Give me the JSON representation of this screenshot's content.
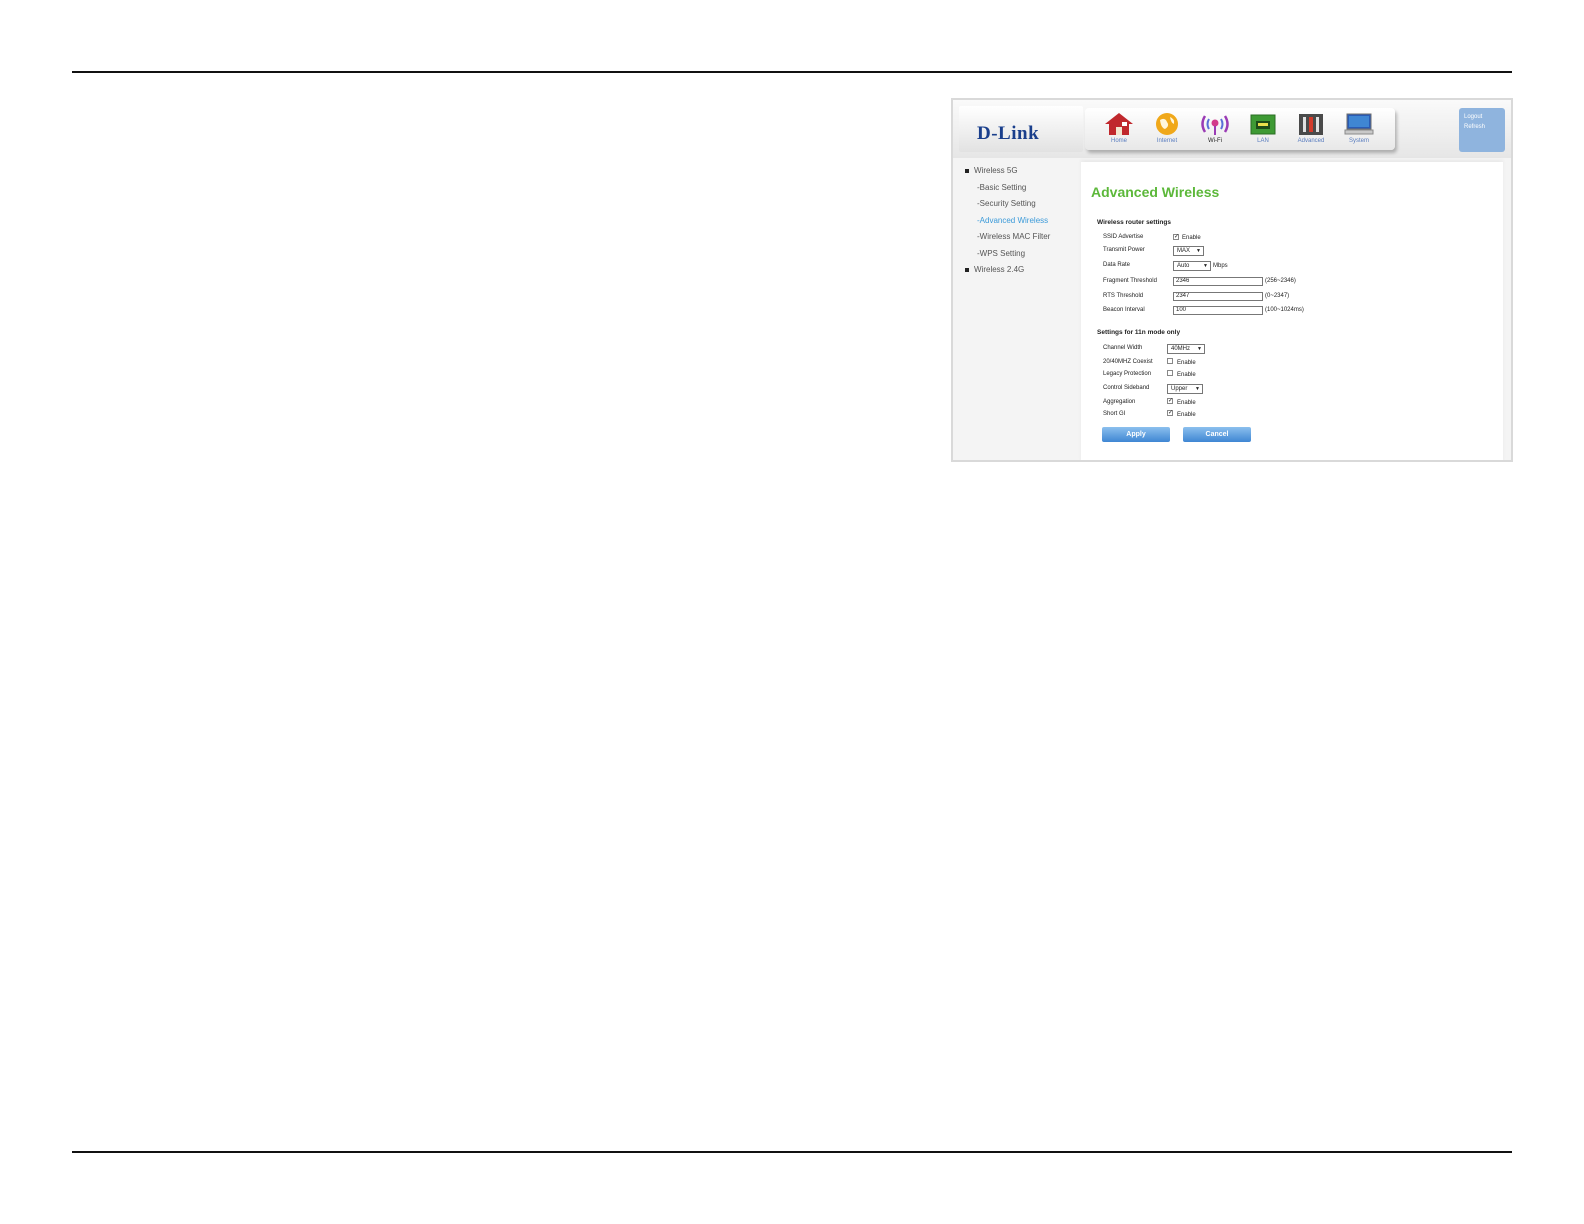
{
  "brand": {
    "logo": "D-Link"
  },
  "nav": [
    {
      "label": "Home",
      "icon": "home-icon"
    },
    {
      "label": "Internet",
      "icon": "globe-icon"
    },
    {
      "label": "Wi-Fi",
      "icon": "wifi-icon"
    },
    {
      "label": "LAN",
      "icon": "lan-port-icon"
    },
    {
      "label": "Advanced",
      "icon": "tools-icon"
    },
    {
      "label": "System",
      "icon": "monitor-icon"
    }
  ],
  "account": {
    "logout": "Logout",
    "refresh": "Refresh"
  },
  "sidebar": {
    "group1": "Wireless 5G",
    "items": [
      "-Basic Setting",
      "-Security Setting",
      "-Advanced Wireless",
      "-Wireless MAC Filter",
      "-WPS Setting"
    ],
    "active_index": 2,
    "group2": "Wireless 2.4G"
  },
  "page_title": "Advanced Wireless",
  "router_settings": {
    "heading": "Wireless router settings",
    "ssid_label": "SSID Advertise",
    "ssid_enable": "Enable",
    "ssid_checked": true,
    "tx_label": "Transmit Power",
    "tx_value": "MAX",
    "rate_label": "Data Rate",
    "rate_value": "Auto",
    "rate_unit": "Mbps",
    "frag_label": "Fragment Threshold",
    "frag_value": "2346",
    "frag_range": "(256~2346)",
    "rts_label": "RTS Threshold",
    "rts_value": "2347",
    "rts_range": "(0~2347)",
    "beacon_label": "Beacon Interval",
    "beacon_value": "100",
    "beacon_range": "(100~1024ms)"
  },
  "n_settings": {
    "heading": "Settings for 11n mode only",
    "cw_label": "Channel Width",
    "cw_value": "40MHz",
    "coexist_label": "20/40MHZ Coexist",
    "coexist_enable": "Enable",
    "coexist_checked": false,
    "legacy_label": "Legacy Protection",
    "legacy_enable": "Enable",
    "legacy_checked": false,
    "sideband_label": "Control Sideband",
    "sideband_value": "Upper",
    "agg_label": "Aggregation",
    "agg_enable": "Enable",
    "agg_checked": true,
    "sgi_label": "Short GI",
    "sgi_enable": "Enable",
    "sgi_checked": true
  },
  "buttons": {
    "apply": "Apply",
    "cancel": "Cancel"
  },
  "colors": {
    "title_green": "#5cb83a",
    "active_link": "#3b9ad9",
    "button_blue": "#3f86d3"
  }
}
